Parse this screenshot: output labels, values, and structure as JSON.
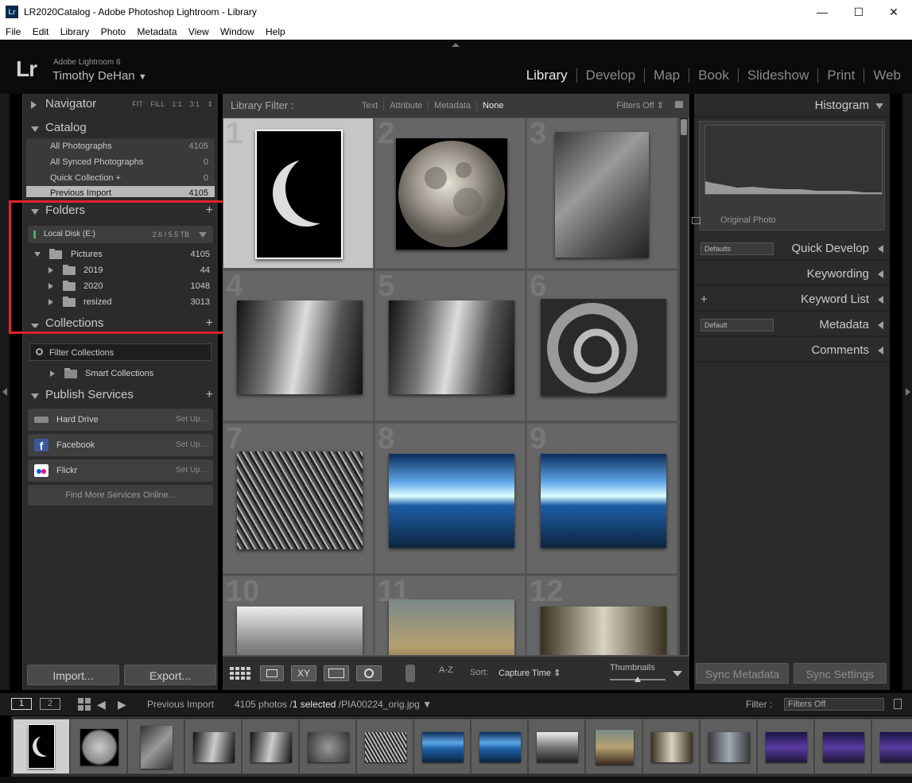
{
  "window": {
    "title": "LR2020Catalog - Adobe Photoshop Lightroom - Library",
    "app_icon": "Lr"
  },
  "menu": [
    "File",
    "Edit",
    "Library",
    "Photo",
    "Metadata",
    "View",
    "Window",
    "Help"
  ],
  "identity": {
    "logo": "Lr",
    "version": "Adobe Lightroom 6",
    "user": "Timothy DeHan",
    "user_caret": "▼"
  },
  "modules": [
    {
      "label": "Library",
      "active": true
    },
    {
      "label": "Develop",
      "active": false
    },
    {
      "label": "Map",
      "active": false
    },
    {
      "label": "Book",
      "active": false
    },
    {
      "label": "Slideshow",
      "active": false
    },
    {
      "label": "Print",
      "active": false
    },
    {
      "label": "Web",
      "active": false
    }
  ],
  "left": {
    "navigator": {
      "title": "Navigator",
      "options": [
        "FIT",
        "FILL",
        "1:1",
        "3:1"
      ],
      "options_caret": "⇕"
    },
    "catalog": {
      "title": "Catalog",
      "items": [
        {
          "label": "All Photographs",
          "count": "4105"
        },
        {
          "label": "All Synced Photographs",
          "count": "0"
        },
        {
          "label": "Quick Collection +",
          "count": "0"
        },
        {
          "label": "Previous Import",
          "count": "4105"
        }
      ]
    },
    "folders": {
      "title": "Folders",
      "add": "+",
      "disk": {
        "label": "Local Disk (E:)",
        "size": "2.6 / 5.5 TB"
      },
      "root": {
        "name": "Pictures",
        "count": "4105"
      },
      "children": [
        {
          "name": "2019",
          "count": "44"
        },
        {
          "name": "2020",
          "count": "1048"
        },
        {
          "name": "resized",
          "count": "3013"
        }
      ]
    },
    "collections": {
      "title": "Collections",
      "add": "+",
      "filter_placeholder": "Filter Collections",
      "smart": "Smart Collections"
    },
    "publish": {
      "title": "Publish Services",
      "add": "+",
      "services": [
        {
          "label": "Hard Drive",
          "action": "Set Up...",
          "color": "#888888"
        },
        {
          "label": "Facebook",
          "action": "Set Up...",
          "color": "#3b5998"
        },
        {
          "label": "Flickr",
          "action": "Set Up...",
          "color": "#ffffff"
        }
      ],
      "find_more": "Find More Services Online..."
    },
    "import_label": "Import...",
    "export_label": "Export..."
  },
  "center": {
    "filter_label": "Library Filter :",
    "filter_options": [
      "Text",
      "Attribute",
      "Metadata",
      "None"
    ],
    "filter_active": "None",
    "filters_off": "Filters Off ⇕",
    "grid_numbers": [
      "1",
      "2",
      "3",
      "4",
      "5",
      "6",
      "7",
      "8",
      "9",
      "10",
      "11",
      "12"
    ],
    "toolbar": {
      "sort_label": "Sort:",
      "sort_value": "Capture Time ⇕",
      "thumbnails_label": "Thumbnails",
      "compare_label": "XY",
      "sort_icon": "A-Z"
    }
  },
  "right": {
    "histogram": "Histogram",
    "original_photo": "Original Photo",
    "quick_develop": "Quick Develop",
    "quick_develop_preset": "Defaults",
    "keywording": "Keywording",
    "keyword_list": "Keyword List",
    "keyword_add": "+",
    "metadata": "Metadata",
    "metadata_preset": "Default",
    "comments": "Comments",
    "sync_metadata": "Sync Metadata",
    "sync_settings": "Sync Settings"
  },
  "filmstrip": {
    "screen1": "1",
    "screen2": "2",
    "source": "Previous Import",
    "count": "4105 photos /",
    "selected": "1 selected",
    "file": "/PIA00224_orig.jpg ▼",
    "filter_label": "Filter :",
    "filter_value": "Filters Off"
  }
}
